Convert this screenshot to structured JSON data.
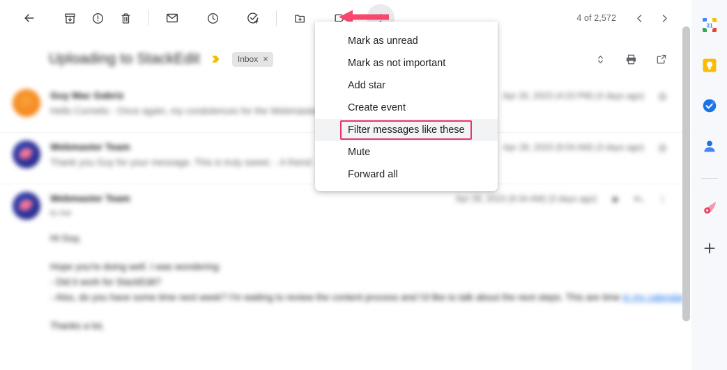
{
  "toolbar": {
    "back_label": "Back to Inbox",
    "buttons": [
      {
        "name": "back-button",
        "icon": "arrow-left-icon"
      },
      {
        "name": "archive-button",
        "icon": "archive-icon"
      },
      {
        "name": "report-spam-button",
        "icon": "report-spam-icon"
      },
      {
        "name": "delete-button",
        "icon": "trash-icon"
      },
      {
        "name": "mark-unread-button",
        "icon": "envelope-icon"
      },
      {
        "name": "snooze-button",
        "icon": "clock-icon"
      },
      {
        "name": "add-to-tasks-button",
        "icon": "task-add-icon"
      },
      {
        "name": "move-to-button",
        "icon": "folder-move-icon"
      },
      {
        "name": "labels-button",
        "icon": "label-tag-icon"
      },
      {
        "name": "more-menu-button",
        "icon": "three-dots-vertical-icon"
      }
    ]
  },
  "pager": {
    "count_text": "4 of 2,572",
    "older_label": "Older",
    "newer_label": "Newer"
  },
  "annotation": {
    "arrow_color": "#f84a6e",
    "arrow_direction": "left",
    "points_at": "more-menu-button",
    "highlight_color": "#e8336d"
  },
  "subject": {
    "text": "Uploading to StackEdit",
    "redacted": true,
    "importance_marker": "important-chevron-icon",
    "label_chip": "Inbox",
    "label_chip_close": "×",
    "actions": [
      {
        "name": "expand-all-button",
        "icon": "expand-collapse-icon"
      },
      {
        "name": "print-button",
        "icon": "printer-icon"
      },
      {
        "name": "open-in-new-window-button",
        "icon": "open-external-icon"
      }
    ]
  },
  "messages": [
    {
      "avatar_color": "#f58a1f",
      "avatar_style": "orange",
      "sender": "Guy Mac Gabriz",
      "snippet": "Hello Cornelis - Once again, my condolences for the Webmaster in",
      "date": "Apr 26, 2023 (4:23 PM) (4 days ago)",
      "expanded": false,
      "redacted": true
    },
    {
      "avatar_color": "#2a2f93",
      "avatar_style": "navy",
      "sender": "Webmaster Team",
      "snippet": "Thank you Guy for your message. This is truly sweet. - A friend",
      "date": "Apr 28, 2023 (9:04 AM) (3 days ago)",
      "expanded": false,
      "redacted": true
    },
    {
      "avatar_color": "#2a2f93",
      "avatar_style": "navy",
      "sender": "Webmaster Team",
      "recipient": "to me",
      "date": "Apr 28, 2023 (9:34 AM) (3 days ago)",
      "expanded": true,
      "redacted": true,
      "body": [
        "Hi Guy,",
        "Hope you're doing well. I was wondering:",
        "- Did it work for StackEdit?",
        "- Also, do you have some time next week? I'm waiting to review the content process and I'd like to talk about the next steps. This are time",
        "Thanks a lot,"
      ],
      "body_link": "in my calendar",
      "actions": [
        {
          "name": "star-message-button",
          "icon": "star-icon"
        },
        {
          "name": "reply-button",
          "icon": "reply-icon"
        },
        {
          "name": "more-options-button",
          "icon": "three-dots-vertical-icon"
        }
      ]
    }
  ],
  "dropdown": {
    "items": [
      {
        "label": "Mark as unread",
        "name": "menu-item-mark-as-unread",
        "highlighted": false
      },
      {
        "label": "Mark as not important",
        "name": "menu-item-mark-as-not-important",
        "highlighted": false
      },
      {
        "label": "Add star",
        "name": "menu-item-add-star",
        "highlighted": false
      },
      {
        "label": "Create event",
        "name": "menu-item-create-event",
        "highlighted": false
      },
      {
        "label": "Filter messages like these",
        "name": "menu-item-filter-messages-like-these",
        "highlighted": true
      },
      {
        "label": "Mute",
        "name": "menu-item-mute",
        "highlighted": false
      },
      {
        "label": "Forward all",
        "name": "menu-item-forward-all",
        "highlighted": false
      }
    ]
  },
  "side_rail": {
    "items": [
      {
        "name": "google-calendar-icon",
        "label": "Calendar",
        "day": "31"
      },
      {
        "name": "google-keep-icon",
        "label": "Keep"
      },
      {
        "name": "google-tasks-icon",
        "label": "Tasks"
      },
      {
        "name": "google-contacts-icon",
        "label": "Contacts"
      },
      {
        "name": "comet-addon-icon",
        "label": "Add-on"
      },
      {
        "name": "add-addon-icon",
        "label": "Get add-ons"
      }
    ]
  }
}
